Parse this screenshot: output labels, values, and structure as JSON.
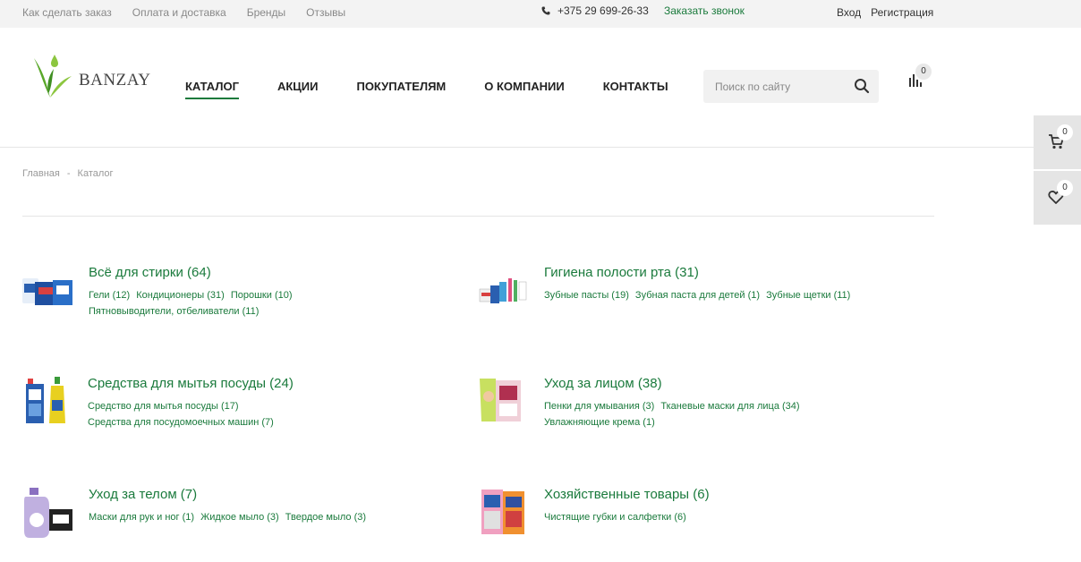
{
  "topbar": {
    "links": [
      "Как сделать заказ",
      "Оплата и доставка",
      "Бренды",
      "Отзывы"
    ],
    "phone": "+375 29 699-26-33",
    "callback": "Заказать звонок",
    "login": "Вход",
    "register": "Регистрация"
  },
  "header": {
    "logo_text": "BANZAY",
    "nav": [
      "КАТАЛОГ",
      "АКЦИИ",
      "ПОКУПАТЕЛЯМ",
      "О КОМПАНИИ",
      "КОНТАКТЫ"
    ],
    "search_placeholder": "Поиск по сайту",
    "compare_count": "0"
  },
  "side": {
    "cart_count": "0",
    "wishlist_count": "0"
  },
  "breadcrumb": {
    "home": "Главная",
    "separator": "-",
    "current": "Каталог"
  },
  "catalog": [
    {
      "title": "Всё для стирки (64)",
      "subs": [
        [
          "Гели (12)",
          "Кондиционеры (31)",
          "Порошки (10)"
        ],
        [
          "Пятновыводители, отбеливатели (11)"
        ]
      ]
    },
    {
      "title": "Гигиена полости рта (31)",
      "subs": [
        [
          "Зубные пасты (19)",
          "Зубная паста для детей (1)",
          "Зубные щетки (11)"
        ]
      ]
    },
    {
      "title": "Средства для мытья посуды (24)",
      "subs": [
        [
          "Средство для мытья посуды (17)"
        ],
        [
          "Средства для посудомоечных машин  (7)"
        ]
      ]
    },
    {
      "title": "Уход за лицом (38)",
      "subs": [
        [
          "Пенки для умывания (3)",
          "Тканевые маски для лица (34)"
        ],
        [
          "Увлажняющие крема (1)"
        ]
      ]
    },
    {
      "title": "Уход за телом (7)",
      "subs": [
        [
          "Маски для рук и ног (1)",
          "Жидкое мыло (3)",
          "Твердое мыло (3)"
        ]
      ]
    },
    {
      "title": "Хозяйственные товары (6)",
      "subs": [
        [
          "Чистящие губки и салфетки (6)"
        ]
      ]
    }
  ],
  "colors": {
    "accent": "#1a7a3c",
    "topbar_bg": "#f3f3f3"
  }
}
